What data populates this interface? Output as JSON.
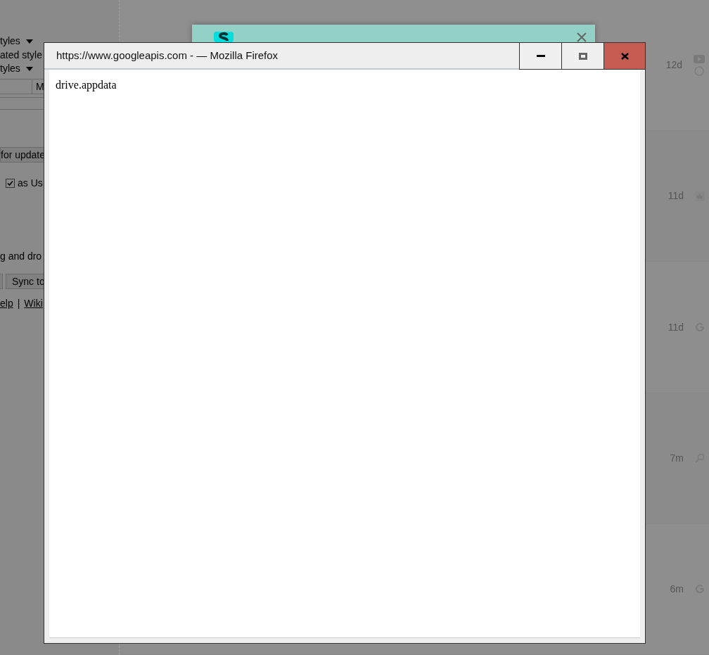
{
  "background_page": {
    "left_panel": {
      "items": [
        {
          "kind": "dropdown",
          "label": "tyles"
        },
        {
          "kind": "text",
          "label": "ated style"
        },
        {
          "kind": "dropdown",
          "label": "tyles"
        },
        {
          "kind": "table_row",
          "cells": [
            "M"
          ]
        },
        {
          "kind": "field"
        },
        {
          "kind": "button",
          "label": "for update"
        },
        {
          "kind": "checkbox",
          "label": "as Us",
          "checked": true
        },
        {
          "kind": "text",
          "label": "g and dro"
        },
        {
          "kind": "buttons",
          "labels": [
            "Sync to"
          ]
        },
        {
          "kind": "links",
          "labels": [
            "elp",
            "Wiki"
          ],
          "separator": "|"
        }
      ]
    },
    "rows": [
      {
        "time": "12d"
      },
      {
        "time": "11d"
      },
      {
        "time": "11d"
      },
      {
        "time": "7m"
      },
      {
        "time": "6m"
      }
    ]
  },
  "window": {
    "title": "https://www.googleapis.com - — Mozilla Firefox",
    "buttons": [
      {
        "kind": "minimize"
      },
      {
        "kind": "maximize"
      },
      {
        "kind": "close"
      }
    ],
    "content": "drive.appdata"
  }
}
